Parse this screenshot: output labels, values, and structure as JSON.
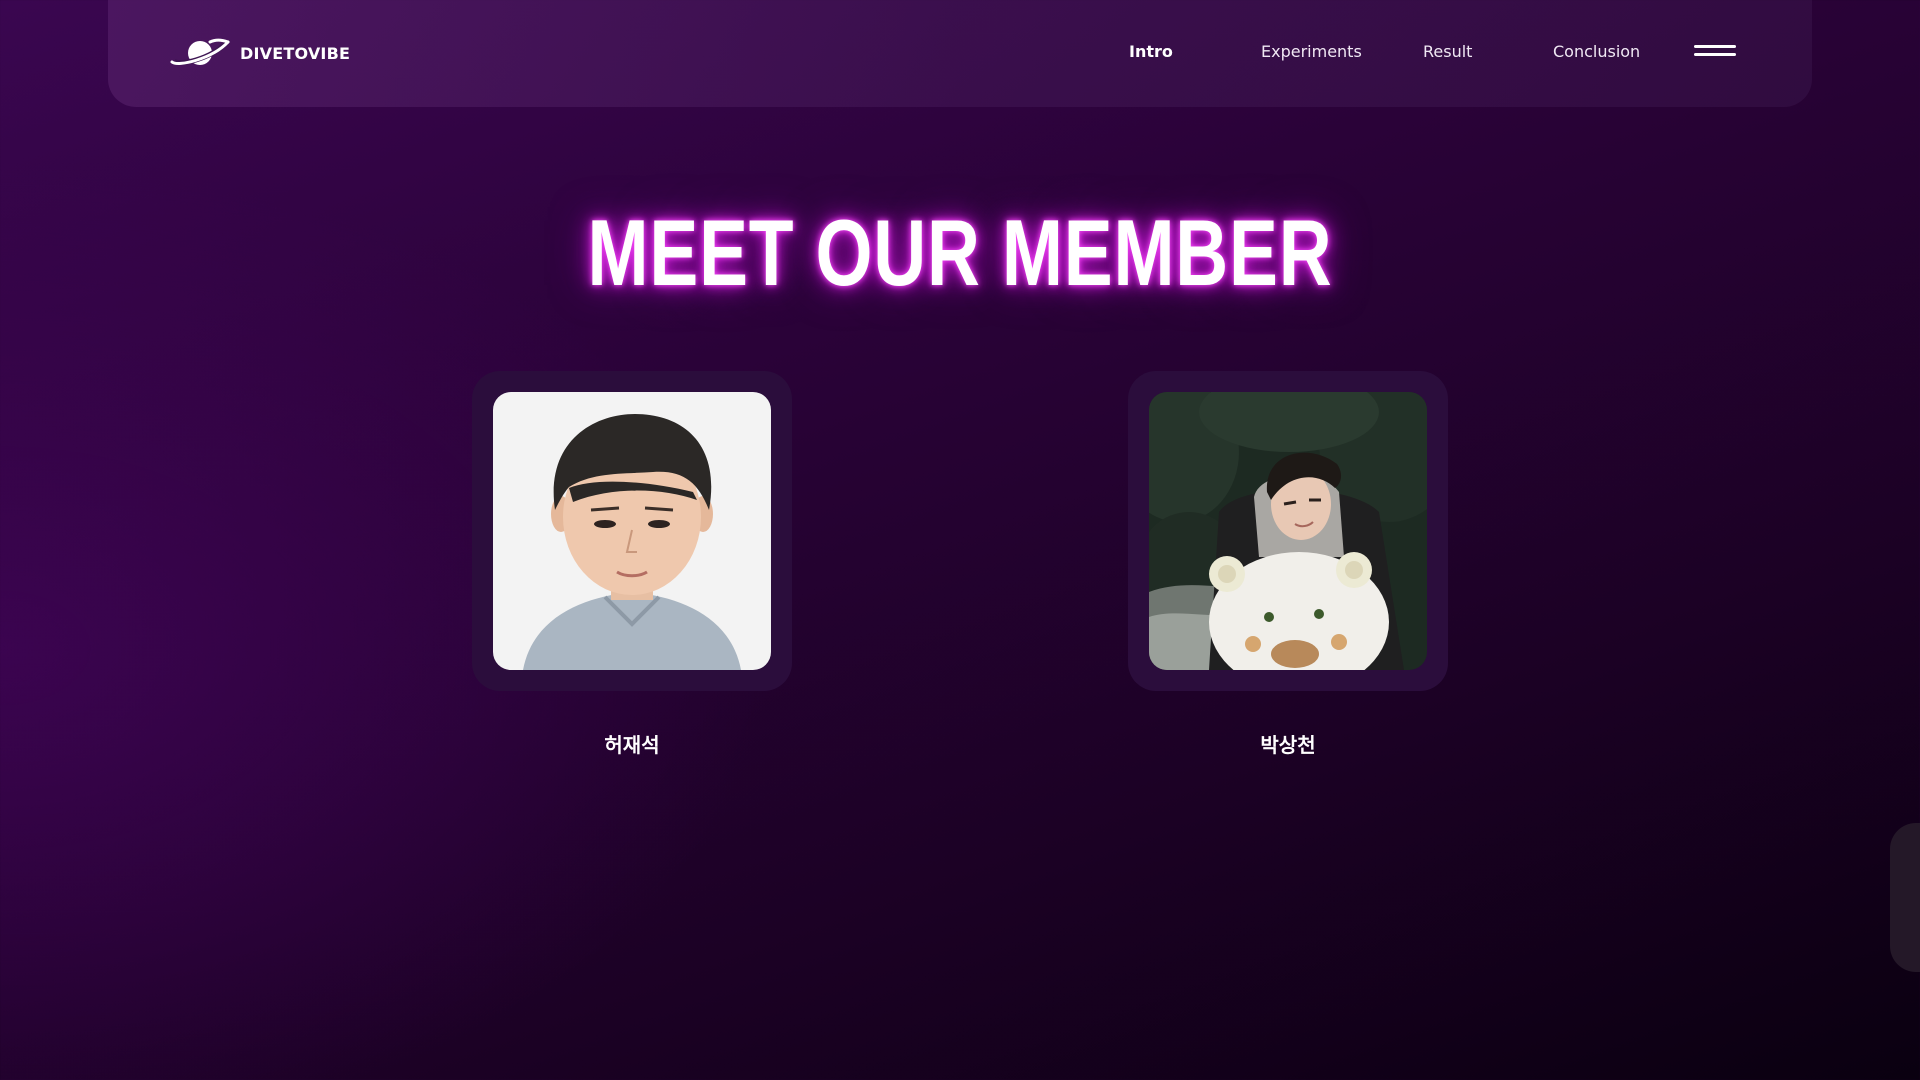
{
  "nav": {
    "brand": "DIVETOVIBE",
    "items": [
      {
        "label": "Intro",
        "active": true
      },
      {
        "label": "Experiments",
        "active": false
      },
      {
        "label": "Result",
        "active": false
      },
      {
        "label": "Conclusion",
        "active": false
      }
    ],
    "menu_icon": "hamburger-menu-icon",
    "logo_icon": "planet-icon"
  },
  "section": {
    "title": "MEET OUR MEMBER"
  },
  "members": [
    {
      "name": "허재석",
      "photo": "portrait-photo"
    },
    {
      "name": "박상천",
      "photo": "snowman-photo"
    }
  ],
  "colors": {
    "background": "#2a0238",
    "glow": "#e028f0",
    "card": "#2b0d3c"
  }
}
